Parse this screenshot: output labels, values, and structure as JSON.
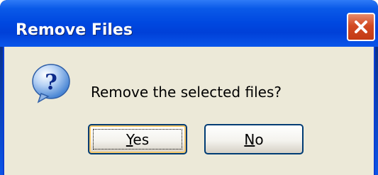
{
  "window": {
    "title": "Remove Files"
  },
  "icons": {
    "dialog_icon": "question-icon",
    "close_icon": "close-icon"
  },
  "message": {
    "text": "Remove the selected files?"
  },
  "buttons": {
    "yes": {
      "mnemonic": "Y",
      "rest": "es"
    },
    "no": {
      "mnemonic": "N",
      "rest": "o"
    }
  },
  "colors": {
    "titlebar": "#0048e0",
    "close_button": "#d24a22",
    "dialog_background": "#ece9d8",
    "button_border": "#003c74"
  }
}
